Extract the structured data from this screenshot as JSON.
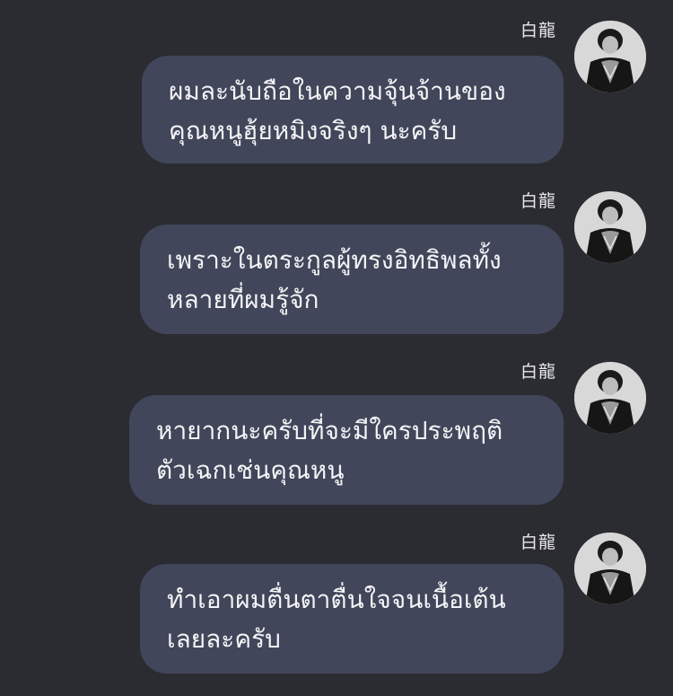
{
  "chat": {
    "messages": [
      {
        "sender": "白龍",
        "lines": [
          "ผมละนับถือในความจุ้นจ้านของ",
          "คุณหนูฮุ้ยหมิงจริงๆ นะครับ"
        ]
      },
      {
        "sender": "白龍",
        "lines": [
          "เพราะในตระกูลผู้ทรงอิทธิพลทั้ง",
          "หลายที่ผมรู้จัก"
        ]
      },
      {
        "sender": "白龍",
        "lines": [
          "หายากนะครับที่จะมีใครประพฤติ",
          "ตัวเฉกเช่นคุณหนู"
        ]
      },
      {
        "sender": "白龍",
        "lines": [
          "ทำเอาผมตื่นตาตื่นใจจนเนื้อเต้น",
          "เลยละครับ"
        ]
      }
    ]
  },
  "colors": {
    "background": "#2b2c32",
    "bubble": "#41465a",
    "text": "#f4f4f6"
  },
  "icons": {
    "avatar": "profile-photo-avatar"
  }
}
